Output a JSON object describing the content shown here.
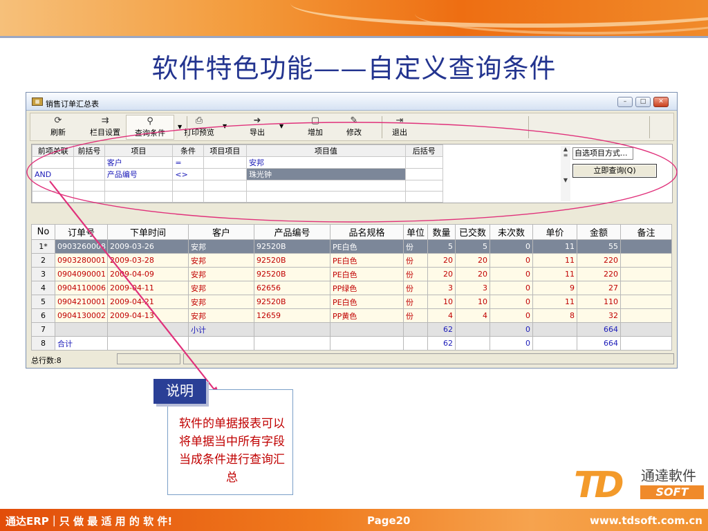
{
  "slide": {
    "title": "软件特色功能——自定义查询条件",
    "note_label": "说明",
    "note_text": "软件的单据报表可以将单据当中所有字段当成条件进行查询汇总"
  },
  "window": {
    "title": "销售订单汇总表",
    "min": "–",
    "max": "□",
    "close": "✕"
  },
  "toolbar": [
    {
      "label": "刷新",
      "icon": "refresh-icon",
      "glyph": "⟳"
    },
    {
      "label": "栏目设置",
      "icon": "columns-icon",
      "glyph": "⇉"
    },
    {
      "label": "查询条件",
      "icon": "binoculars-icon",
      "glyph": "⚲"
    },
    {
      "label": "打印预览",
      "icon": "print-icon",
      "glyph": "⎙"
    },
    {
      "label": "导出",
      "icon": "export-icon",
      "glyph": "➜"
    },
    {
      "label": "增加",
      "icon": "add-icon",
      "glyph": "▢"
    },
    {
      "label": "修改",
      "icon": "edit-icon",
      "glyph": "✎"
    },
    {
      "label": "退出",
      "icon": "exit-icon",
      "glyph": "⇥"
    }
  ],
  "criteria": {
    "headers": [
      "前项关联",
      "前括号",
      "项目",
      "条件",
      "项目项目",
      "项目值",
      "后括号"
    ],
    "rows": [
      [
        "",
        "",
        "客户",
        "=",
        "",
        "安邦",
        ""
      ],
      [
        "AND",
        "",
        "产品编号",
        "<>",
        "",
        "珠光钟",
        ""
      ]
    ],
    "selection_mode": "自选项目方式...",
    "query_button": "立即查询(Q)"
  },
  "grid": {
    "headers": [
      "No",
      "订单号",
      "下单时间",
      "客户",
      "产品编号",
      "品名规格",
      "单位",
      "数量",
      "已交数",
      "未次数",
      "单价",
      "金额",
      "备注"
    ],
    "rows": [
      [
        "1*",
        "0903260008",
        "2009-03-26",
        "安邦",
        "92520B",
        "PE白色",
        "份",
        "5",
        "5",
        "0",
        "11",
        "55",
        ""
      ],
      [
        "2",
        "0903280001",
        "2009-03-28",
        "安邦",
        "92520B",
        "PE白色",
        "份",
        "20",
        "20",
        "0",
        "11",
        "220",
        ""
      ],
      [
        "3",
        "0904090001",
        "2009-04-09",
        "安邦",
        "92520B",
        "PE白色",
        "份",
        "20",
        "20",
        "0",
        "11",
        "220",
        ""
      ],
      [
        "4",
        "0904110006",
        "2009-04-11",
        "安邦",
        "62656",
        "PP绿色",
        "份",
        "3",
        "3",
        "0",
        "9",
        "27",
        ""
      ],
      [
        "5",
        "0904210001",
        "2009-04-21",
        "安邦",
        "92520B",
        "PE白色",
        "份",
        "10",
        "10",
        "0",
        "11",
        "110",
        ""
      ],
      [
        "6",
        "0904130002",
        "2009-04-13",
        "安邦",
        "12659",
        "PP黄色",
        "份",
        "4",
        "4",
        "0",
        "8",
        "32",
        ""
      ]
    ],
    "subtotal": {
      "no": "7",
      "label": "小计",
      "qty": "62",
      "pending": "0",
      "amount": "664"
    },
    "total": {
      "no": "8",
      "label": "合计",
      "qty": "62",
      "pending": "0",
      "amount": "664"
    }
  },
  "status": {
    "rows": "总行数:8"
  },
  "logo": {
    "mark": "TD",
    "cn": "通達軟件",
    "en": "SOFT"
  },
  "footer": {
    "left": "通达ERP｜只 做 最 适 用 的 软 件!",
    "page": "Page20",
    "url": "www.tdsoft.com.cn"
  }
}
